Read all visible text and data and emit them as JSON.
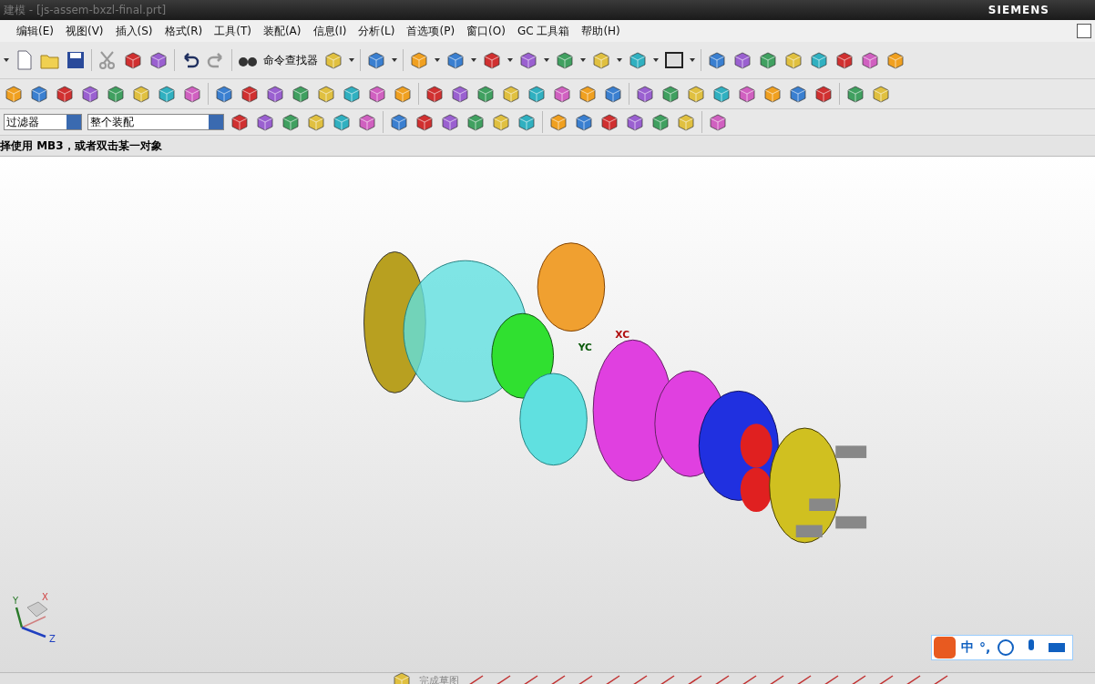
{
  "window": {
    "title": "建模 - [js-assem-bxzl-final.prt]",
    "brand": "SIEMENS"
  },
  "menu": [
    "编辑(E)",
    "视图(V)",
    "插入(S)",
    "格式(R)",
    "工具(T)",
    "装配(A)",
    "信息(I)",
    "分析(L)",
    "首选项(P)",
    "窗口(O)",
    "GC 工具箱",
    "帮助(H)"
  ],
  "toolbar": {
    "command_finder": "命令查找器"
  },
  "selection_bar": {
    "filter": "过滤器",
    "scope": "整个装配"
  },
  "status_bar": {
    "prompt": "择使用 MB3，或者双击某一对象"
  },
  "viewport": {
    "wcs_labels": [
      "YC",
      "XC"
    ],
    "triad_labels": [
      "X",
      "Y",
      "Z"
    ]
  },
  "ime_bar": {
    "mode": "中",
    "punctuation": "°,"
  },
  "sketch_toolbar": {
    "finish_sketch": "完成草图"
  }
}
